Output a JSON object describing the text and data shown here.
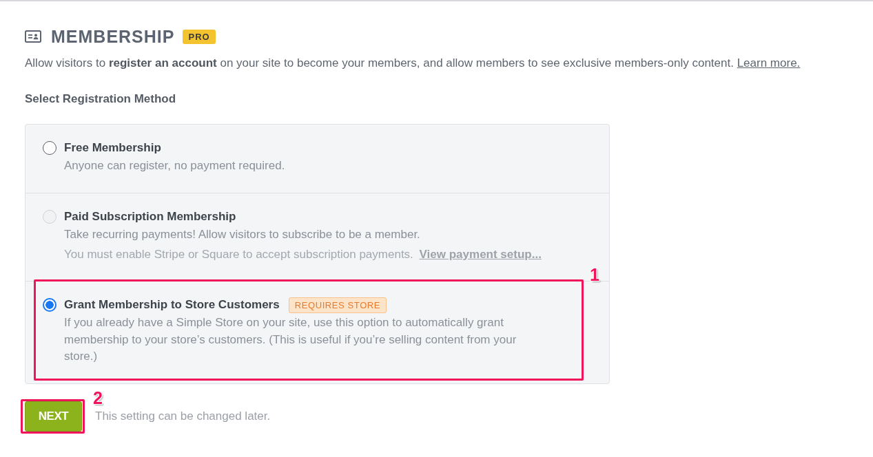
{
  "header": {
    "title": "MEMBERSHIP",
    "badge": "PRO"
  },
  "intro": {
    "text": "Allow visitors to **register an account** on your site to become your members, and allow members to see exclusive members-only content.",
    "link": "Learn more."
  },
  "section_label": "Select Registration Method",
  "options": [
    {
      "title": "Free Membership",
      "description": "Anyone can register, no payment required.",
      "selected": false,
      "disabled": false
    },
    {
      "title": "Paid Subscription Membership",
      "description": "Take recurring payments! Allow visitors to subscribe to be a member.",
      "note": "You must enable Stripe or Square to accept subscription payments.",
      "note_link": "View payment setup...",
      "selected": false,
      "disabled": true
    },
    {
      "title": "Grant Membership to Store Customers",
      "badge": "REQUIRES STORE",
      "description": "If you already have a Simple Store on your site, use this option to automatically grant membership to your store’s customers. (This is useful if you’re selling content from your store.)",
      "selected": true,
      "disabled": false,
      "callout": "1"
    }
  ],
  "next_button": {
    "label": "NEXT",
    "callout": "2"
  },
  "hint": "This setting can be changed later."
}
